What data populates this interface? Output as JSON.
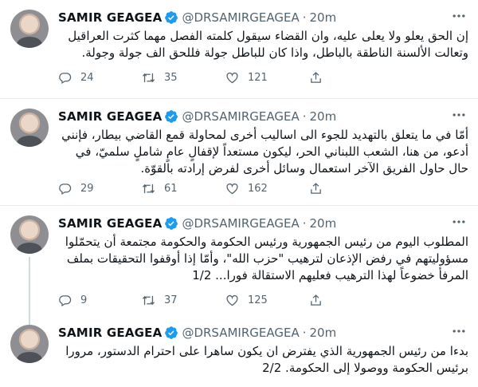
{
  "tweets": [
    {
      "name": "SAMIR GEAGEA",
      "handle": "@DRSAMIRGEAGEA",
      "separator": "·",
      "time": "20m",
      "text": "إن الحق يعلو ولا يعلى عليه، وان القضاء سيقول كلمته الفصل مهما كثرت العراقيل وتعالت الألسنة الناطقة بالباطل، واذا كان للباطل جولة فللحق الف جولة وجولة.",
      "replies": "24",
      "retweets": "35",
      "likes": "121"
    },
    {
      "name": "SAMIR GEAGEA",
      "handle": "@DRSAMIRGEAGEA",
      "separator": "·",
      "time": "20m",
      "text": "أمّا في ما يتعلق بالتهديد للجوء الى اساليب أخرى لمحاولة قمع القاضي بيطار، فإنني أدعو، من هنا، الشعب اللبناني الحر، ليكون مستعداً لإقفالٍ عامٍ شاملٍ سلميّ، في حال حاول الفريق الآخر استعمال وسائل أخرى لفرض إرادته بالقوّة.",
      "replies": "29",
      "retweets": "61",
      "likes": "162"
    },
    {
      "name": "SAMIR GEAGEA",
      "handle": "@DRSAMIRGEAGEA",
      "separator": "·",
      "time": "20m",
      "text": "المطلوب اليوم من رئيس الجمهورية ورئيس الحكومة والحكومة مجتمعة أن يتحمّلوا مسؤوليتهم في رفض الإذعان لترهيب \"حزب الله\"، وأمّا إذا أوقفوا التحقيقات بملف المرفأ خضوعاً لهذا الترهيب فعليهم الاستقالة فورا... 1/2",
      "replies": "9",
      "retweets": "37",
      "likes": "125"
    },
    {
      "name": "SAMIR GEAGEA",
      "handle": "@DRSAMIRGEAGEA",
      "separator": "·",
      "time": "20m",
      "text": "بدءا من رئيس الجمهورية الذي يفترض ان يكون ساهرا على احترام الدستور، مرورا برئيس الحكومة ووصولا إلى الحكومة. 2/2"
    }
  ],
  "colors": {
    "verified": "#1d9bf0",
    "icon": "#536471",
    "divider": "#e6ecf0"
  },
  "icons": [
    "verified-badge-icon",
    "more-icon",
    "reply-icon",
    "retweet-icon",
    "like-icon",
    "share-icon"
  ]
}
